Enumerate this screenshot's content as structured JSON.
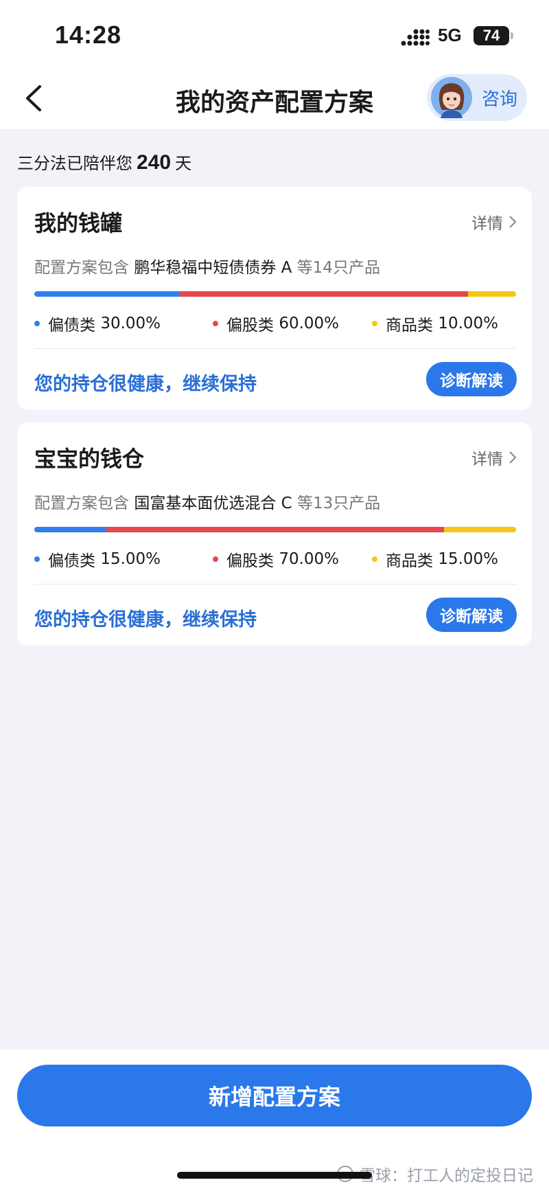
{
  "status_bar": {
    "time": "14:28",
    "network": "5G",
    "battery": "74"
  },
  "nav": {
    "title": "我的资产配置方案",
    "consult_label": "咨询"
  },
  "intro": {
    "prefix": "三分法已陪伴您",
    "days": "240",
    "suffix": "天"
  },
  "colors": {
    "bond": "#2f80ed",
    "stock": "#e5484d",
    "commodity": "#f5c518",
    "accent": "#2a78ea"
  },
  "plans": [
    {
      "name": "我的钱罐",
      "detail_label": "详情",
      "contains_prefix": "配置方案包含",
      "product": "鹏华稳福中短债债券 A",
      "contains_suffix": "等14只产品",
      "allocation": [
        {
          "label": "偏债类",
          "value": "30.00%",
          "share": 30
        },
        {
          "label": "偏股类",
          "value": "60.00%",
          "share": 60
        },
        {
          "label": "商品类",
          "value": "10.00%",
          "share": 10
        }
      ],
      "health_text": "您的持仓很健康，继续保持",
      "diagnose_label": "诊断解读"
    },
    {
      "name": "宝宝的钱仓",
      "detail_label": "详情",
      "contains_prefix": "配置方案包含",
      "product": "国富基本面优选混合 C",
      "contains_suffix": "等13只产品",
      "allocation": [
        {
          "label": "偏债类",
          "value": "15.00%",
          "share": 15
        },
        {
          "label": "偏股类",
          "value": "70.00%",
          "share": 70
        },
        {
          "label": "商品类",
          "value": "15.00%",
          "share": 15
        }
      ],
      "health_text": "您的持仓很健康，继续保持",
      "diagnose_label": "诊断解读"
    }
  ],
  "add_button": "新增配置方案",
  "watermark": "雪球：打工人的定投日记"
}
